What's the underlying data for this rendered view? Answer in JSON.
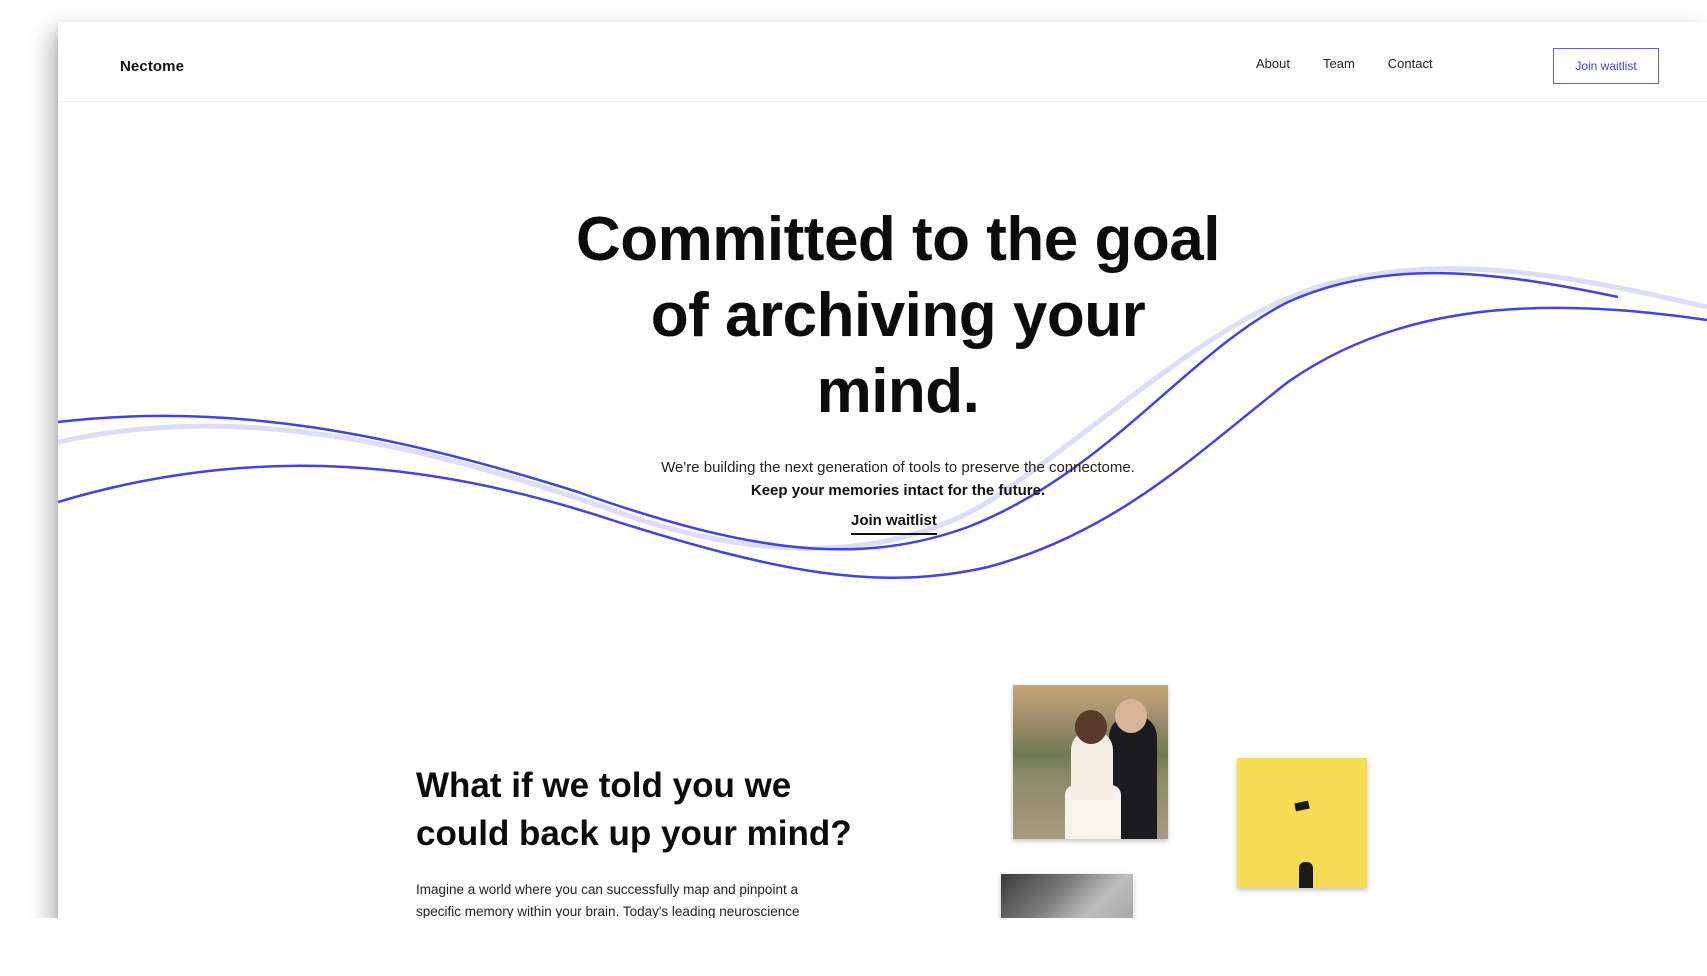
{
  "header": {
    "brand": "Nectome",
    "nav": [
      {
        "label": "About"
      },
      {
        "label": "Team"
      },
      {
        "label": "Contact"
      }
    ],
    "cta_label": "Join waitlist"
  },
  "hero": {
    "title": "Committed to the goal\nof archiving your\nmind.",
    "subtitle": "We're building the next generation of tools to preserve the connectome.",
    "subtitle_strong": "Keep your memories intact for the future.",
    "cta_label": "Join waitlist"
  },
  "section": {
    "title": "What if we told you we\ncould back up your mind?",
    "body": "Imagine a world where you can successfully map and pinpoint a\nspecific memory within your brain. Today's leading neuroscience\nresearch suggests that it is possible by preserving your connectome."
  },
  "colors": {
    "wave_primary": "#3f42e6",
    "wave_light": "#d9dbfb",
    "button_border": "#5b5cf0"
  }
}
